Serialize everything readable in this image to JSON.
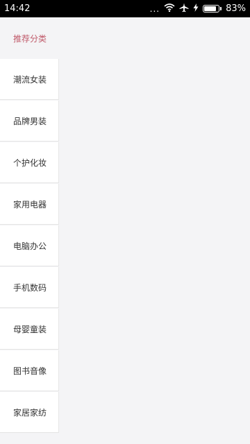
{
  "status_bar": {
    "time": "14:42",
    "dots": "...",
    "battery_percent": "83%",
    "battery_level": 0.83,
    "icons": [
      "wifi-icon",
      "airplane-icon",
      "charging-icon",
      "battery-icon"
    ]
  },
  "sidebar": {
    "header": "推荐分类",
    "header_color": "#c05a6a",
    "items": [
      {
        "label": "潮流女装"
      },
      {
        "label": "品牌男装"
      },
      {
        "label": "个护化妆"
      },
      {
        "label": "家用电器"
      },
      {
        "label": "电脑办公"
      },
      {
        "label": "手机数码"
      },
      {
        "label": "母婴童装"
      },
      {
        "label": "图书音像"
      },
      {
        "label": "家居家纺"
      }
    ]
  }
}
